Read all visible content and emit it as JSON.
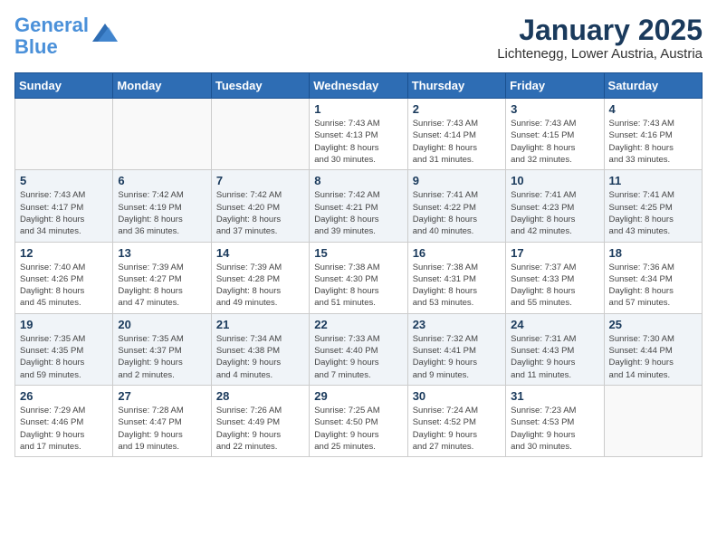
{
  "logo": {
    "general": "General",
    "blue": "Blue"
  },
  "title": "January 2025",
  "location": "Lichtenegg, Lower Austria, Austria",
  "days_header": [
    "Sunday",
    "Monday",
    "Tuesday",
    "Wednesday",
    "Thursday",
    "Friday",
    "Saturday"
  ],
  "weeks": [
    {
      "shade": false,
      "days": [
        {
          "num": "",
          "detail": ""
        },
        {
          "num": "",
          "detail": ""
        },
        {
          "num": "",
          "detail": ""
        },
        {
          "num": "1",
          "detail": "Sunrise: 7:43 AM\nSunset: 4:13 PM\nDaylight: 8 hours\nand 30 minutes."
        },
        {
          "num": "2",
          "detail": "Sunrise: 7:43 AM\nSunset: 4:14 PM\nDaylight: 8 hours\nand 31 minutes."
        },
        {
          "num": "3",
          "detail": "Sunrise: 7:43 AM\nSunset: 4:15 PM\nDaylight: 8 hours\nand 32 minutes."
        },
        {
          "num": "4",
          "detail": "Sunrise: 7:43 AM\nSunset: 4:16 PM\nDaylight: 8 hours\nand 33 minutes."
        }
      ]
    },
    {
      "shade": true,
      "days": [
        {
          "num": "5",
          "detail": "Sunrise: 7:43 AM\nSunset: 4:17 PM\nDaylight: 8 hours\nand 34 minutes."
        },
        {
          "num": "6",
          "detail": "Sunrise: 7:42 AM\nSunset: 4:19 PM\nDaylight: 8 hours\nand 36 minutes."
        },
        {
          "num": "7",
          "detail": "Sunrise: 7:42 AM\nSunset: 4:20 PM\nDaylight: 8 hours\nand 37 minutes."
        },
        {
          "num": "8",
          "detail": "Sunrise: 7:42 AM\nSunset: 4:21 PM\nDaylight: 8 hours\nand 39 minutes."
        },
        {
          "num": "9",
          "detail": "Sunrise: 7:41 AM\nSunset: 4:22 PM\nDaylight: 8 hours\nand 40 minutes."
        },
        {
          "num": "10",
          "detail": "Sunrise: 7:41 AM\nSunset: 4:23 PM\nDaylight: 8 hours\nand 42 minutes."
        },
        {
          "num": "11",
          "detail": "Sunrise: 7:41 AM\nSunset: 4:25 PM\nDaylight: 8 hours\nand 43 minutes."
        }
      ]
    },
    {
      "shade": false,
      "days": [
        {
          "num": "12",
          "detail": "Sunrise: 7:40 AM\nSunset: 4:26 PM\nDaylight: 8 hours\nand 45 minutes."
        },
        {
          "num": "13",
          "detail": "Sunrise: 7:39 AM\nSunset: 4:27 PM\nDaylight: 8 hours\nand 47 minutes."
        },
        {
          "num": "14",
          "detail": "Sunrise: 7:39 AM\nSunset: 4:28 PM\nDaylight: 8 hours\nand 49 minutes."
        },
        {
          "num": "15",
          "detail": "Sunrise: 7:38 AM\nSunset: 4:30 PM\nDaylight: 8 hours\nand 51 minutes."
        },
        {
          "num": "16",
          "detail": "Sunrise: 7:38 AM\nSunset: 4:31 PM\nDaylight: 8 hours\nand 53 minutes."
        },
        {
          "num": "17",
          "detail": "Sunrise: 7:37 AM\nSunset: 4:33 PM\nDaylight: 8 hours\nand 55 minutes."
        },
        {
          "num": "18",
          "detail": "Sunrise: 7:36 AM\nSunset: 4:34 PM\nDaylight: 8 hours\nand 57 minutes."
        }
      ]
    },
    {
      "shade": true,
      "days": [
        {
          "num": "19",
          "detail": "Sunrise: 7:35 AM\nSunset: 4:35 PM\nDaylight: 8 hours\nand 59 minutes."
        },
        {
          "num": "20",
          "detail": "Sunrise: 7:35 AM\nSunset: 4:37 PM\nDaylight: 9 hours\nand 2 minutes."
        },
        {
          "num": "21",
          "detail": "Sunrise: 7:34 AM\nSunset: 4:38 PM\nDaylight: 9 hours\nand 4 minutes."
        },
        {
          "num": "22",
          "detail": "Sunrise: 7:33 AM\nSunset: 4:40 PM\nDaylight: 9 hours\nand 7 minutes."
        },
        {
          "num": "23",
          "detail": "Sunrise: 7:32 AM\nSunset: 4:41 PM\nDaylight: 9 hours\nand 9 minutes."
        },
        {
          "num": "24",
          "detail": "Sunrise: 7:31 AM\nSunset: 4:43 PM\nDaylight: 9 hours\nand 11 minutes."
        },
        {
          "num": "25",
          "detail": "Sunrise: 7:30 AM\nSunset: 4:44 PM\nDaylight: 9 hours\nand 14 minutes."
        }
      ]
    },
    {
      "shade": false,
      "days": [
        {
          "num": "26",
          "detail": "Sunrise: 7:29 AM\nSunset: 4:46 PM\nDaylight: 9 hours\nand 17 minutes."
        },
        {
          "num": "27",
          "detail": "Sunrise: 7:28 AM\nSunset: 4:47 PM\nDaylight: 9 hours\nand 19 minutes."
        },
        {
          "num": "28",
          "detail": "Sunrise: 7:26 AM\nSunset: 4:49 PM\nDaylight: 9 hours\nand 22 minutes."
        },
        {
          "num": "29",
          "detail": "Sunrise: 7:25 AM\nSunset: 4:50 PM\nDaylight: 9 hours\nand 25 minutes."
        },
        {
          "num": "30",
          "detail": "Sunrise: 7:24 AM\nSunset: 4:52 PM\nDaylight: 9 hours\nand 27 minutes."
        },
        {
          "num": "31",
          "detail": "Sunrise: 7:23 AM\nSunset: 4:53 PM\nDaylight: 9 hours\nand 30 minutes."
        },
        {
          "num": "",
          "detail": ""
        }
      ]
    }
  ]
}
